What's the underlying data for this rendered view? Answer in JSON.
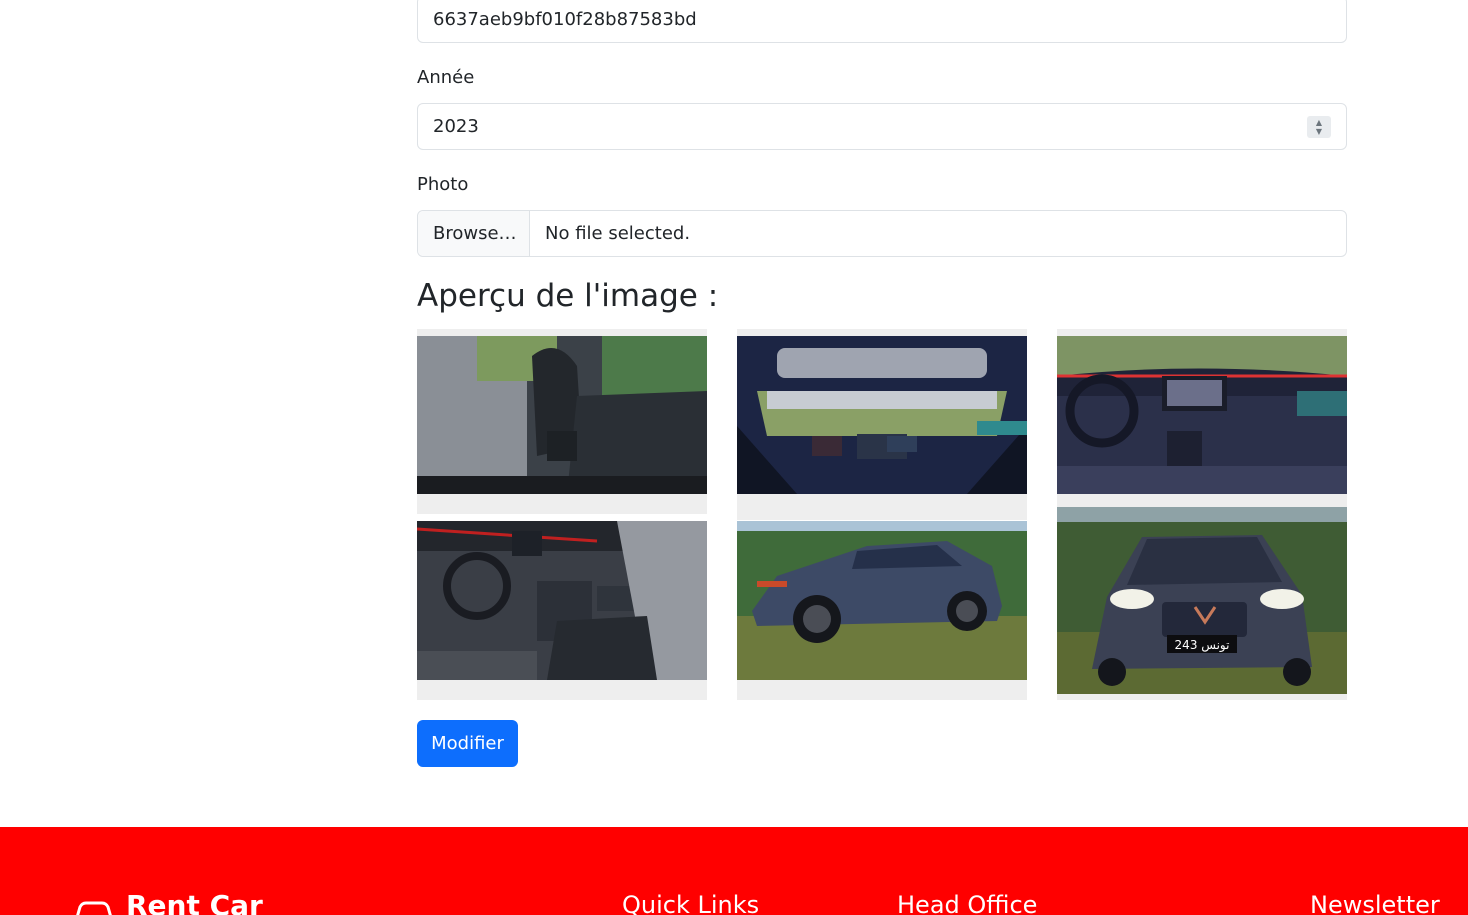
{
  "form": {
    "id_value": "6637aeb9bf010f28b87583bd",
    "year_label": "Année",
    "year_value": "2023",
    "photo_label": "Photo",
    "browse_label": "Browse…",
    "file_status": "No file selected.",
    "preview_title": "Aperçu de l'image :",
    "submit_label": "Modifier"
  },
  "preview_images": [
    {
      "name": "car-rear-seats-photo"
    },
    {
      "name": "car-sunroof-dashboard-photo"
    },
    {
      "name": "car-dashboard-photo"
    },
    {
      "name": "car-front-interior-photo"
    },
    {
      "name": "car-side-view-photo"
    },
    {
      "name": "car-front-view-photo",
      "plate_text": "243 تونس"
    }
  ],
  "footer": {
    "brand": "Rent Car",
    "quick_links": "Quick Links",
    "head_office": "Head Office",
    "newsletter": "Newsletter"
  },
  "colors": {
    "primary_button": "#0d6efd",
    "footer_bg": "#ff0000",
    "thumb_bg": "#eeeeee"
  }
}
